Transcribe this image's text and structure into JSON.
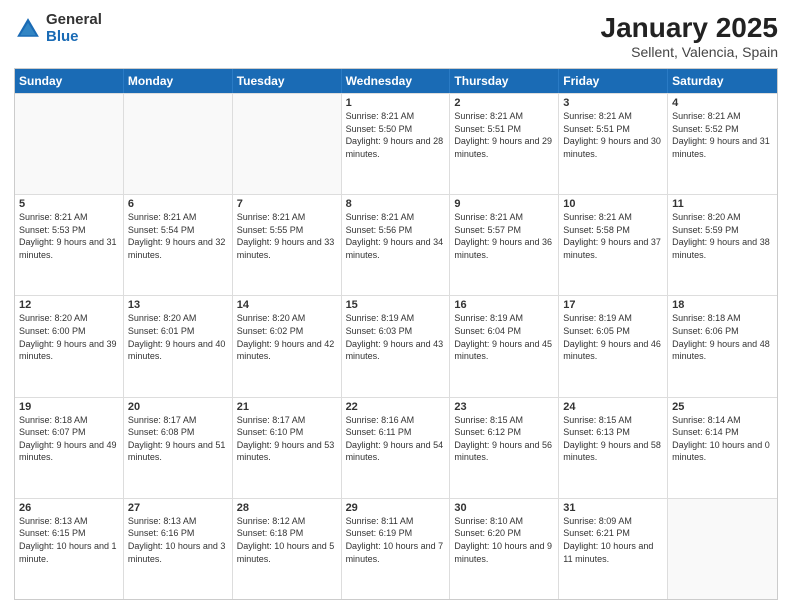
{
  "logo": {
    "general": "General",
    "blue": "Blue"
  },
  "header": {
    "title": "January 2025",
    "subtitle": "Sellent, Valencia, Spain"
  },
  "weekdays": [
    "Sunday",
    "Monday",
    "Tuesday",
    "Wednesday",
    "Thursday",
    "Friday",
    "Saturday"
  ],
  "weeks": [
    [
      {
        "day": "",
        "sunrise": "",
        "sunset": "",
        "daylight": ""
      },
      {
        "day": "",
        "sunrise": "",
        "sunset": "",
        "daylight": ""
      },
      {
        "day": "",
        "sunrise": "",
        "sunset": "",
        "daylight": ""
      },
      {
        "day": "1",
        "sunrise": "Sunrise: 8:21 AM",
        "sunset": "Sunset: 5:50 PM",
        "daylight": "Daylight: 9 hours and 28 minutes."
      },
      {
        "day": "2",
        "sunrise": "Sunrise: 8:21 AM",
        "sunset": "Sunset: 5:51 PM",
        "daylight": "Daylight: 9 hours and 29 minutes."
      },
      {
        "day": "3",
        "sunrise": "Sunrise: 8:21 AM",
        "sunset": "Sunset: 5:51 PM",
        "daylight": "Daylight: 9 hours and 30 minutes."
      },
      {
        "day": "4",
        "sunrise": "Sunrise: 8:21 AM",
        "sunset": "Sunset: 5:52 PM",
        "daylight": "Daylight: 9 hours and 31 minutes."
      }
    ],
    [
      {
        "day": "5",
        "sunrise": "Sunrise: 8:21 AM",
        "sunset": "Sunset: 5:53 PM",
        "daylight": "Daylight: 9 hours and 31 minutes."
      },
      {
        "day": "6",
        "sunrise": "Sunrise: 8:21 AM",
        "sunset": "Sunset: 5:54 PM",
        "daylight": "Daylight: 9 hours and 32 minutes."
      },
      {
        "day": "7",
        "sunrise": "Sunrise: 8:21 AM",
        "sunset": "Sunset: 5:55 PM",
        "daylight": "Daylight: 9 hours and 33 minutes."
      },
      {
        "day": "8",
        "sunrise": "Sunrise: 8:21 AM",
        "sunset": "Sunset: 5:56 PM",
        "daylight": "Daylight: 9 hours and 34 minutes."
      },
      {
        "day": "9",
        "sunrise": "Sunrise: 8:21 AM",
        "sunset": "Sunset: 5:57 PM",
        "daylight": "Daylight: 9 hours and 36 minutes."
      },
      {
        "day": "10",
        "sunrise": "Sunrise: 8:21 AM",
        "sunset": "Sunset: 5:58 PM",
        "daylight": "Daylight: 9 hours and 37 minutes."
      },
      {
        "day": "11",
        "sunrise": "Sunrise: 8:20 AM",
        "sunset": "Sunset: 5:59 PM",
        "daylight": "Daylight: 9 hours and 38 minutes."
      }
    ],
    [
      {
        "day": "12",
        "sunrise": "Sunrise: 8:20 AM",
        "sunset": "Sunset: 6:00 PM",
        "daylight": "Daylight: 9 hours and 39 minutes."
      },
      {
        "day": "13",
        "sunrise": "Sunrise: 8:20 AM",
        "sunset": "Sunset: 6:01 PM",
        "daylight": "Daylight: 9 hours and 40 minutes."
      },
      {
        "day": "14",
        "sunrise": "Sunrise: 8:20 AM",
        "sunset": "Sunset: 6:02 PM",
        "daylight": "Daylight: 9 hours and 42 minutes."
      },
      {
        "day": "15",
        "sunrise": "Sunrise: 8:19 AM",
        "sunset": "Sunset: 6:03 PM",
        "daylight": "Daylight: 9 hours and 43 minutes."
      },
      {
        "day": "16",
        "sunrise": "Sunrise: 8:19 AM",
        "sunset": "Sunset: 6:04 PM",
        "daylight": "Daylight: 9 hours and 45 minutes."
      },
      {
        "day": "17",
        "sunrise": "Sunrise: 8:19 AM",
        "sunset": "Sunset: 6:05 PM",
        "daylight": "Daylight: 9 hours and 46 minutes."
      },
      {
        "day": "18",
        "sunrise": "Sunrise: 8:18 AM",
        "sunset": "Sunset: 6:06 PM",
        "daylight": "Daylight: 9 hours and 48 minutes."
      }
    ],
    [
      {
        "day": "19",
        "sunrise": "Sunrise: 8:18 AM",
        "sunset": "Sunset: 6:07 PM",
        "daylight": "Daylight: 9 hours and 49 minutes."
      },
      {
        "day": "20",
        "sunrise": "Sunrise: 8:17 AM",
        "sunset": "Sunset: 6:08 PM",
        "daylight": "Daylight: 9 hours and 51 minutes."
      },
      {
        "day": "21",
        "sunrise": "Sunrise: 8:17 AM",
        "sunset": "Sunset: 6:10 PM",
        "daylight": "Daylight: 9 hours and 53 minutes."
      },
      {
        "day": "22",
        "sunrise": "Sunrise: 8:16 AM",
        "sunset": "Sunset: 6:11 PM",
        "daylight": "Daylight: 9 hours and 54 minutes."
      },
      {
        "day": "23",
        "sunrise": "Sunrise: 8:15 AM",
        "sunset": "Sunset: 6:12 PM",
        "daylight": "Daylight: 9 hours and 56 minutes."
      },
      {
        "day": "24",
        "sunrise": "Sunrise: 8:15 AM",
        "sunset": "Sunset: 6:13 PM",
        "daylight": "Daylight: 9 hours and 58 minutes."
      },
      {
        "day": "25",
        "sunrise": "Sunrise: 8:14 AM",
        "sunset": "Sunset: 6:14 PM",
        "daylight": "Daylight: 10 hours and 0 minutes."
      }
    ],
    [
      {
        "day": "26",
        "sunrise": "Sunrise: 8:13 AM",
        "sunset": "Sunset: 6:15 PM",
        "daylight": "Daylight: 10 hours and 1 minute."
      },
      {
        "day": "27",
        "sunrise": "Sunrise: 8:13 AM",
        "sunset": "Sunset: 6:16 PM",
        "daylight": "Daylight: 10 hours and 3 minutes."
      },
      {
        "day": "28",
        "sunrise": "Sunrise: 8:12 AM",
        "sunset": "Sunset: 6:18 PM",
        "daylight": "Daylight: 10 hours and 5 minutes."
      },
      {
        "day": "29",
        "sunrise": "Sunrise: 8:11 AM",
        "sunset": "Sunset: 6:19 PM",
        "daylight": "Daylight: 10 hours and 7 minutes."
      },
      {
        "day": "30",
        "sunrise": "Sunrise: 8:10 AM",
        "sunset": "Sunset: 6:20 PM",
        "daylight": "Daylight: 10 hours and 9 minutes."
      },
      {
        "day": "31",
        "sunrise": "Sunrise: 8:09 AM",
        "sunset": "Sunset: 6:21 PM",
        "daylight": "Daylight: 10 hours and 11 minutes."
      },
      {
        "day": "",
        "sunrise": "",
        "sunset": "",
        "daylight": ""
      }
    ]
  ]
}
